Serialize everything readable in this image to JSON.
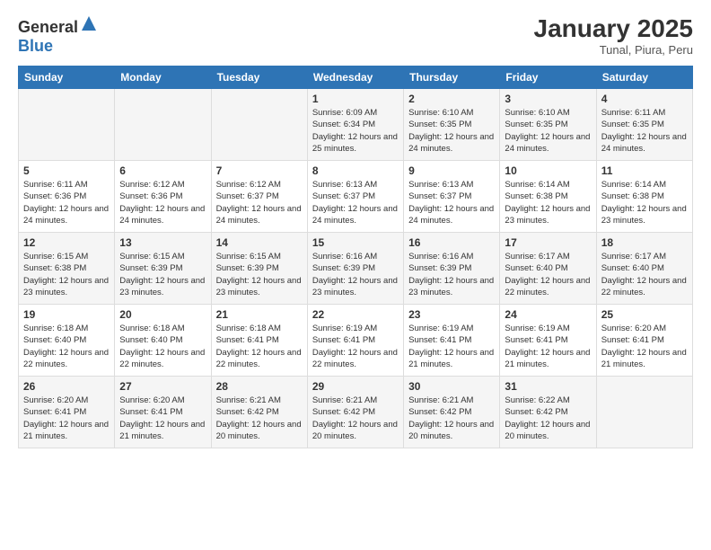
{
  "logo": {
    "general": "General",
    "blue": "Blue"
  },
  "header": {
    "month": "January 2025",
    "location": "Tunal, Piura, Peru"
  },
  "weekdays": [
    "Sunday",
    "Monday",
    "Tuesday",
    "Wednesday",
    "Thursday",
    "Friday",
    "Saturday"
  ],
  "weeks": [
    [
      {
        "day": "",
        "sunrise": "",
        "sunset": "",
        "daylight": ""
      },
      {
        "day": "",
        "sunrise": "",
        "sunset": "",
        "daylight": ""
      },
      {
        "day": "",
        "sunrise": "",
        "sunset": "",
        "daylight": ""
      },
      {
        "day": "1",
        "sunrise": "6:09 AM",
        "sunset": "6:34 PM",
        "daylight": "12 hours and 25 minutes."
      },
      {
        "day": "2",
        "sunrise": "6:10 AM",
        "sunset": "6:35 PM",
        "daylight": "12 hours and 24 minutes."
      },
      {
        "day": "3",
        "sunrise": "6:10 AM",
        "sunset": "6:35 PM",
        "daylight": "12 hours and 24 minutes."
      },
      {
        "day": "4",
        "sunrise": "6:11 AM",
        "sunset": "6:35 PM",
        "daylight": "12 hours and 24 minutes."
      }
    ],
    [
      {
        "day": "5",
        "sunrise": "6:11 AM",
        "sunset": "6:36 PM",
        "daylight": "12 hours and 24 minutes."
      },
      {
        "day": "6",
        "sunrise": "6:12 AM",
        "sunset": "6:36 PM",
        "daylight": "12 hours and 24 minutes."
      },
      {
        "day": "7",
        "sunrise": "6:12 AM",
        "sunset": "6:37 PM",
        "daylight": "12 hours and 24 minutes."
      },
      {
        "day": "8",
        "sunrise": "6:13 AM",
        "sunset": "6:37 PM",
        "daylight": "12 hours and 24 minutes."
      },
      {
        "day": "9",
        "sunrise": "6:13 AM",
        "sunset": "6:37 PM",
        "daylight": "12 hours and 24 minutes."
      },
      {
        "day": "10",
        "sunrise": "6:14 AM",
        "sunset": "6:38 PM",
        "daylight": "12 hours and 23 minutes."
      },
      {
        "day": "11",
        "sunrise": "6:14 AM",
        "sunset": "6:38 PM",
        "daylight": "12 hours and 23 minutes."
      }
    ],
    [
      {
        "day": "12",
        "sunrise": "6:15 AM",
        "sunset": "6:38 PM",
        "daylight": "12 hours and 23 minutes."
      },
      {
        "day": "13",
        "sunrise": "6:15 AM",
        "sunset": "6:39 PM",
        "daylight": "12 hours and 23 minutes."
      },
      {
        "day": "14",
        "sunrise": "6:15 AM",
        "sunset": "6:39 PM",
        "daylight": "12 hours and 23 minutes."
      },
      {
        "day": "15",
        "sunrise": "6:16 AM",
        "sunset": "6:39 PM",
        "daylight": "12 hours and 23 minutes."
      },
      {
        "day": "16",
        "sunrise": "6:16 AM",
        "sunset": "6:39 PM",
        "daylight": "12 hours and 23 minutes."
      },
      {
        "day": "17",
        "sunrise": "6:17 AM",
        "sunset": "6:40 PM",
        "daylight": "12 hours and 22 minutes."
      },
      {
        "day": "18",
        "sunrise": "6:17 AM",
        "sunset": "6:40 PM",
        "daylight": "12 hours and 22 minutes."
      }
    ],
    [
      {
        "day": "19",
        "sunrise": "6:18 AM",
        "sunset": "6:40 PM",
        "daylight": "12 hours and 22 minutes."
      },
      {
        "day": "20",
        "sunrise": "6:18 AM",
        "sunset": "6:40 PM",
        "daylight": "12 hours and 22 minutes."
      },
      {
        "day": "21",
        "sunrise": "6:18 AM",
        "sunset": "6:41 PM",
        "daylight": "12 hours and 22 minutes."
      },
      {
        "day": "22",
        "sunrise": "6:19 AM",
        "sunset": "6:41 PM",
        "daylight": "12 hours and 22 minutes."
      },
      {
        "day": "23",
        "sunrise": "6:19 AM",
        "sunset": "6:41 PM",
        "daylight": "12 hours and 21 minutes."
      },
      {
        "day": "24",
        "sunrise": "6:19 AM",
        "sunset": "6:41 PM",
        "daylight": "12 hours and 21 minutes."
      },
      {
        "day": "25",
        "sunrise": "6:20 AM",
        "sunset": "6:41 PM",
        "daylight": "12 hours and 21 minutes."
      }
    ],
    [
      {
        "day": "26",
        "sunrise": "6:20 AM",
        "sunset": "6:41 PM",
        "daylight": "12 hours and 21 minutes."
      },
      {
        "day": "27",
        "sunrise": "6:20 AM",
        "sunset": "6:41 PM",
        "daylight": "12 hours and 21 minutes."
      },
      {
        "day": "28",
        "sunrise": "6:21 AM",
        "sunset": "6:42 PM",
        "daylight": "12 hours and 20 minutes."
      },
      {
        "day": "29",
        "sunrise": "6:21 AM",
        "sunset": "6:42 PM",
        "daylight": "12 hours and 20 minutes."
      },
      {
        "day": "30",
        "sunrise": "6:21 AM",
        "sunset": "6:42 PM",
        "daylight": "12 hours and 20 minutes."
      },
      {
        "day": "31",
        "sunrise": "6:22 AM",
        "sunset": "6:42 PM",
        "daylight": "12 hours and 20 minutes."
      },
      {
        "day": "",
        "sunrise": "",
        "sunset": "",
        "daylight": ""
      }
    ]
  ],
  "labels": {
    "sunrise": "Sunrise:",
    "sunset": "Sunset:",
    "daylight": "Daylight hours"
  }
}
